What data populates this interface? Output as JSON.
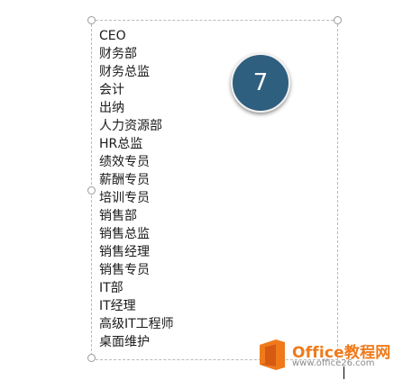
{
  "textbox": {
    "lines": [
      "CEO",
      "财务部",
      "财务总监",
      "会计",
      "出纳",
      "人力资源部",
      "HR总监",
      "绩效专员",
      "薪酬专员",
      "培训专员",
      "销售部",
      "销售总监",
      "销售经理",
      "销售专员",
      "IT部",
      "IT经理",
      "高级IT工程师",
      "桌面维护"
    ]
  },
  "step_badge": {
    "number": "7",
    "color": "#2f5f7f"
  },
  "watermark": {
    "brand": "Office教程网",
    "url": "www.office26.com",
    "accent_color": "#f07a1a",
    "icon": "office-logo-icon"
  }
}
